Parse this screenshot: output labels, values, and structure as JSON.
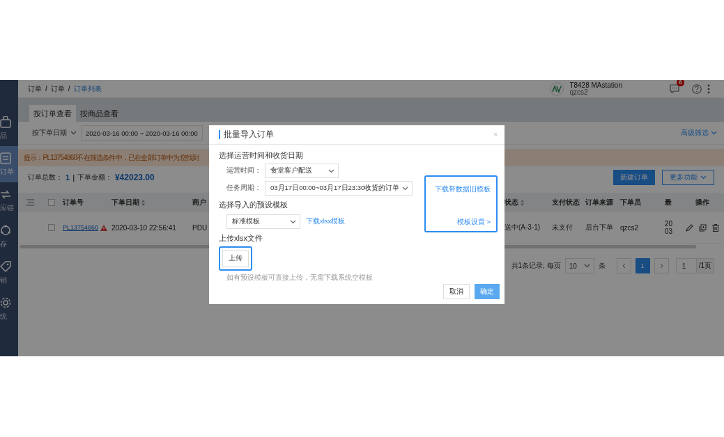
{
  "sidebar": {
    "items": [
      {
        "label": "品",
        "selected": false
      },
      {
        "label": "订单",
        "selected": true
      },
      {
        "label": "应链",
        "selected": false
      },
      {
        "label": "存",
        "selected": false
      },
      {
        "label": "销",
        "selected": false
      },
      {
        "label": "统",
        "selected": false
      }
    ]
  },
  "breadcrumb": {
    "separator": "/",
    "items": [
      {
        "label": "订单",
        "current": false
      },
      {
        "label": "订单",
        "current": false
      },
      {
        "label": "订单列表",
        "current": true
      }
    ]
  },
  "account": {
    "store": "T8428 MAstation",
    "user": "qzcs2",
    "message_count": "6"
  },
  "tabs": [
    {
      "label": "按订单查看",
      "selected": true
    },
    {
      "label": "按商品查看",
      "selected": false
    }
  ],
  "filter": {
    "date_type": "按下单日期",
    "date_range": "2020-03-16 00:00 ~ 2020-03-16 00:00",
    "advanced": "高级筛选"
  },
  "notice": "提示：PL13754860不在筛选条件中，已在全部订单中为您找到",
  "summary": {
    "count_label": "订单总数：",
    "count": "1",
    "separator": "|",
    "amount_label": "下单金额：",
    "amount": "¥42023.00"
  },
  "actions": [
    {
      "label": "新建订单",
      "kind": "primary"
    },
    {
      "label": "更多功能",
      "kind": "dropdown"
    }
  ],
  "table": {
    "select_all": {
      "checked": false
    },
    "columns": [
      {
        "label": "订单号",
        "sortable": false
      },
      {
        "label": "下单日期",
        "sortable": true
      },
      {
        "label": "商户",
        "sortable": false
      },
      {
        "label": "状态",
        "sortable": true
      },
      {
        "label": "支付状态",
        "sortable": false
      },
      {
        "label": "订单来源",
        "sortable": false
      },
      {
        "label": "下单员",
        "sortable": false
      },
      {
        "label": "最",
        "sortable": false
      },
      {
        "label": "操作",
        "sortable": false
      }
    ],
    "rows": [
      {
        "checked": false,
        "warning": true,
        "cells": [
          "PL13754860",
          "2020-03-10 22:56:41",
          "PDU",
          "送中(A-3-1)",
          "未支付",
          "后台下单",
          "qzcs2",
          [
            "20",
            "03"
          ]
        ]
      }
    ]
  },
  "pagination": {
    "summary": "共1条记录, 每页",
    "page_size": "10",
    "unit": "条",
    "pages": [
      {
        "label": "1",
        "selected": true
      }
    ],
    "jump_value": "1",
    "page_total": "/1页"
  },
  "dialog": {
    "title": "批量导入订单",
    "close": "×",
    "section_1": "选择运营时间和收货日期",
    "fields": [
      {
        "label": "运营时间：",
        "value": "食堂客户配送"
      },
      {
        "label": "任务周期：",
        "value": "03月17日00:00~03月17日23:30收货的订单"
      }
    ],
    "section_2": "选择导入的预设模板",
    "template": {
      "value": "标准模板",
      "link": "下载xlsx模板"
    },
    "section_3": "上传xlsx文件",
    "upload": {
      "label": "上传",
      "highlighted": true
    },
    "hint": "如有预设模板可直接上传，无需下载系统空模板",
    "side_panel": {
      "highlighted": true,
      "links": [
        "下载带数据旧模板",
        "模板设置 >"
      ]
    },
    "buttons": [
      {
        "label": "取消",
        "kind": "default"
      },
      {
        "label": "确定",
        "kind": "primary"
      }
    ]
  }
}
